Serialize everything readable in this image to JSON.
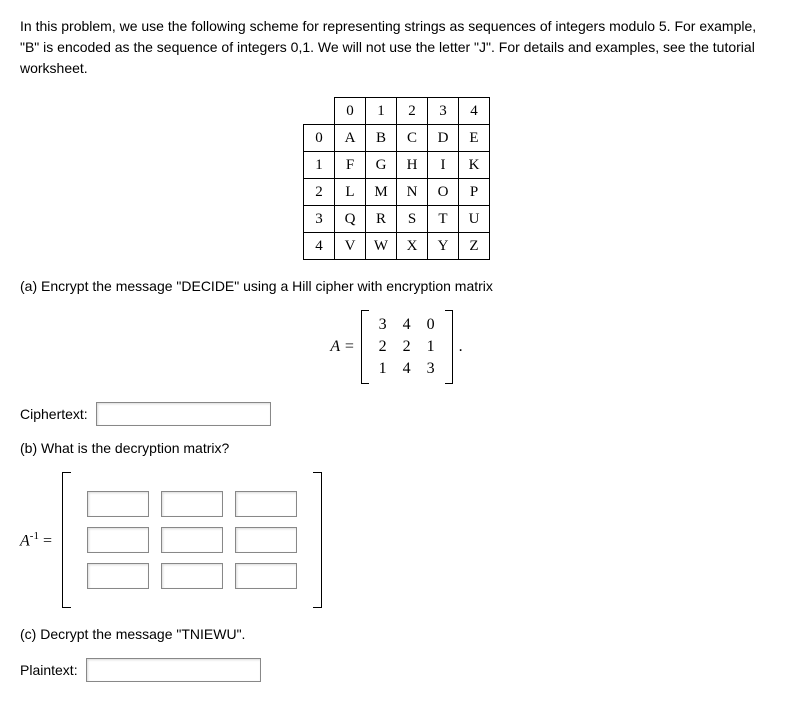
{
  "intro": "In this problem, we use the following scheme for representing strings as sequences of integers modulo 5. For example, \"B\" is encoded as the sequence of integers 0,1. We will not use the letter \"J\". For details and examples, see the tutorial worksheet.",
  "encoding": {
    "cols": [
      "0",
      "1",
      "2",
      "3",
      "4"
    ],
    "rows": [
      {
        "h": "0",
        "cells": [
          "A",
          "B",
          "C",
          "D",
          "E"
        ]
      },
      {
        "h": "1",
        "cells": [
          "F",
          "G",
          "H",
          "I",
          "K"
        ]
      },
      {
        "h": "2",
        "cells": [
          "L",
          "M",
          "N",
          "O",
          "P"
        ]
      },
      {
        "h": "3",
        "cells": [
          "Q",
          "R",
          "S",
          "T",
          "U"
        ]
      },
      {
        "h": "4",
        "cells": [
          "V",
          "W",
          "X",
          "Y",
          "Z"
        ]
      }
    ]
  },
  "partA": {
    "prompt": "(a) Encrypt the message \"DECIDE\" using a Hill cipher with encryption matrix",
    "matrix_lhs": "A =",
    "rows": [
      [
        "3",
        "4",
        "0"
      ],
      [
        "2",
        "2",
        "1"
      ],
      [
        "1",
        "4",
        "3"
      ]
    ],
    "trailing": "."
  },
  "ciphertext_label": "Ciphertext:",
  "partB": {
    "prompt": "(b) What is the decryption matrix?",
    "lhs": "A",
    "lhs_sup": "-1",
    "lhs_eq": " ="
  },
  "partC": {
    "prompt": "(c) Decrypt the message \"TNIEWU\"."
  },
  "plaintext_label": "Plaintext:"
}
